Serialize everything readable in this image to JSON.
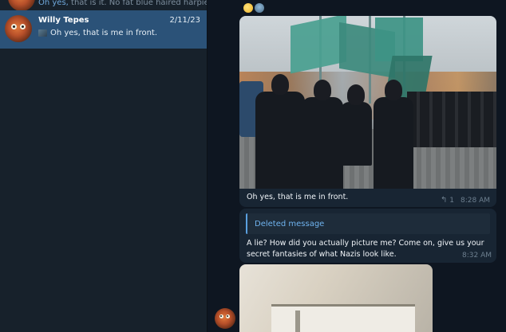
{
  "sidebar": {
    "previous_chat": {
      "preview_highlight": "Oh yes,",
      "preview_rest": " that is it. No fat blue haired harpies ..."
    },
    "active_chat": {
      "name": "Willy Tepes",
      "date": "2/11/23",
      "preview": "Oh yes, that is me in front."
    }
  },
  "conversation": {
    "photo_message": {
      "caption": "Oh yes, that is me in front.",
      "reply_count": "1",
      "time": "8:28 AM"
    },
    "text_message": {
      "quoted": "Deleted message",
      "body": "A lie? How did you actually picture me? Come on, give us your secret fantasies of what Nazis look like.",
      "time": "8:32 AM"
    }
  },
  "icons": {
    "reply": "reply-icon",
    "reaction_1": "emoji-icon",
    "reaction_2": "sticker-icon"
  },
  "colors": {
    "sidebar_bg": "#17212b",
    "active_row": "#2b5278",
    "chat_bg": "#0e1621",
    "bubble": "#182533",
    "accent": "#6fb3ef"
  }
}
